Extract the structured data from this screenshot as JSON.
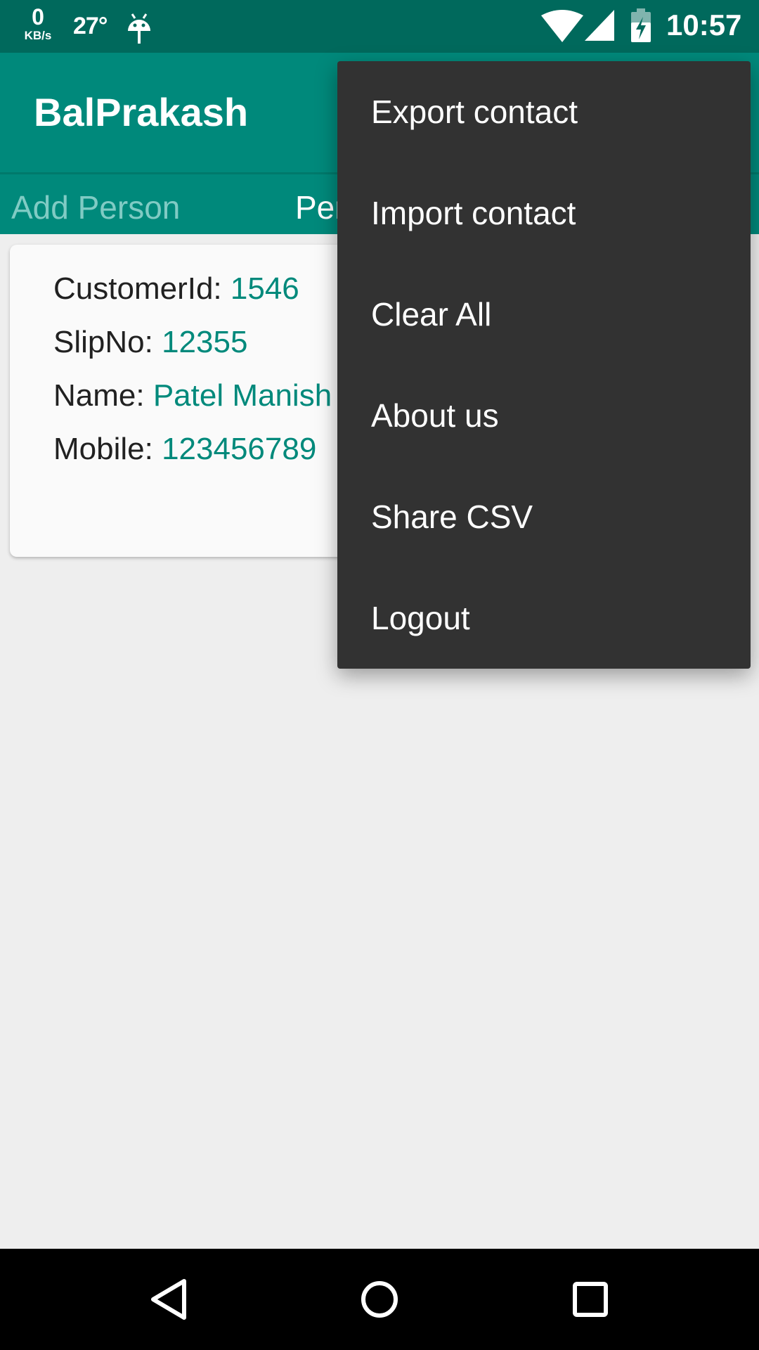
{
  "status_bar": {
    "net_speed_value": "0",
    "net_speed_unit": "KB/s",
    "temperature": "27°",
    "time": "10:57",
    "icons": [
      "android-icon",
      "wifi-icon",
      "cell-signal-icon",
      "battery-charging-icon"
    ]
  },
  "app_bar": {
    "title": "BalPrakash"
  },
  "tabs": [
    {
      "label": "Add Person"
    },
    {
      "label": "Person"
    }
  ],
  "card": {
    "rows": [
      {
        "label": "CustomerId: ",
        "value": "1546"
      },
      {
        "label": "SlipNo: ",
        "value": "12355"
      },
      {
        "label": "Name: ",
        "value": "Patel Manish"
      },
      {
        "label": "Mobile: ",
        "value": "123456789"
      }
    ]
  },
  "menu": {
    "items": [
      {
        "label": "Export contact"
      },
      {
        "label": "Import contact"
      },
      {
        "label": "Clear All"
      },
      {
        "label": "About us"
      },
      {
        "label": "Share CSV"
      },
      {
        "label": "Logout"
      }
    ]
  },
  "nav_bar": {
    "buttons": [
      "back-icon",
      "home-icon",
      "recents-icon"
    ]
  },
  "colors": {
    "status_bar": "#00695c",
    "primary": "#00897b",
    "tab_inactive": "#80cbc4",
    "menu_background": "#323232",
    "background": "#eeeeee",
    "card": "#fafafa"
  }
}
